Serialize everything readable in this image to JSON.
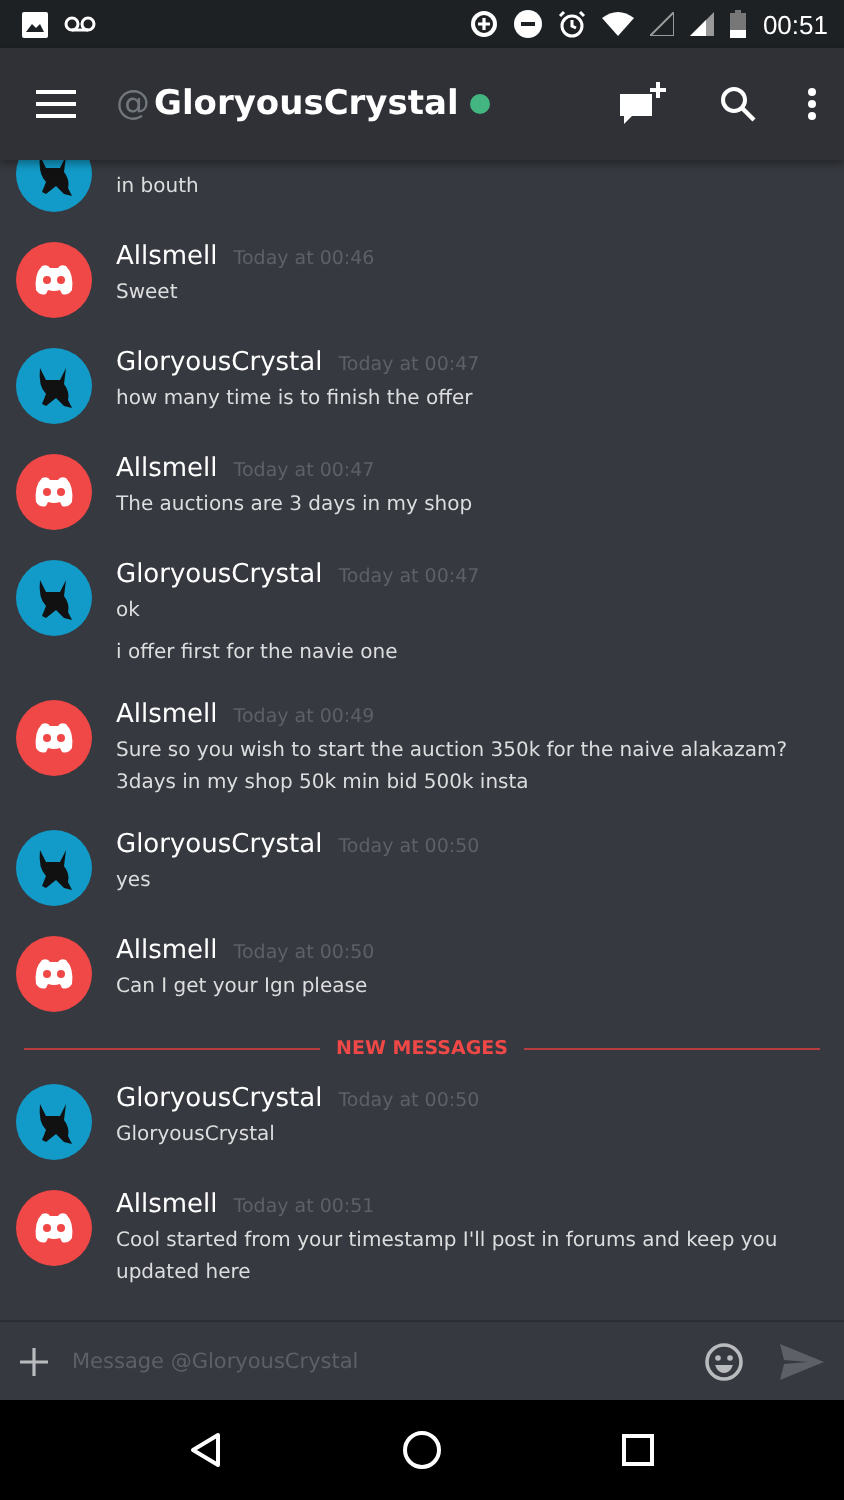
{
  "status_bar": {
    "time": "00:51"
  },
  "header": {
    "at": "@",
    "title": "GloryousCrystal",
    "online": true
  },
  "messages": [
    {
      "kind": "user",
      "lines": [
        "in bouth"
      ]
    },
    {
      "kind": "bot",
      "author": "Allsmell",
      "time": "Today at 00:46",
      "lines": [
        "Sweet"
      ]
    },
    {
      "kind": "user",
      "author": "GloryousCrystal",
      "time": "Today at 00:47",
      "lines": [
        "how many time is to finish the offer"
      ]
    },
    {
      "kind": "bot",
      "author": "Allsmell",
      "time": "Today at 00:47",
      "lines": [
        "The auctions are 3 days in my shop"
      ]
    },
    {
      "kind": "user",
      "author": "GloryousCrystal",
      "time": "Today at 00:47",
      "lines": [
        "ok"
      ],
      "extra": [
        "i offer first  for the navie one"
      ]
    },
    {
      "kind": "bot",
      "author": "Allsmell",
      "time": "Today at 00:49",
      "lines": [
        "Sure so you wish to start the auction 350k for the naive alakazam? 3days in my shop 50k min bid 500k insta"
      ]
    },
    {
      "kind": "user",
      "author": "GloryousCrystal",
      "time": "Today at 00:50",
      "lines": [
        "yes"
      ]
    },
    {
      "kind": "bot",
      "author": "Allsmell",
      "time": "Today at 00:50",
      "lines": [
        "Can I get your Ign please"
      ]
    },
    {
      "kind": "divider",
      "label": "NEW MESSAGES"
    },
    {
      "kind": "user",
      "author": "GloryousCrystal",
      "time": "Today at 00:50",
      "lines": [
        "GloryousCrystal"
      ]
    },
    {
      "kind": "bot",
      "author": "Allsmell",
      "time": "Today at 00:51",
      "lines": [
        "Cool started from your timestamp I'll post in forums and keep you updated here"
      ]
    }
  ],
  "composer": {
    "placeholder": "Message @GloryousCrystal"
  }
}
